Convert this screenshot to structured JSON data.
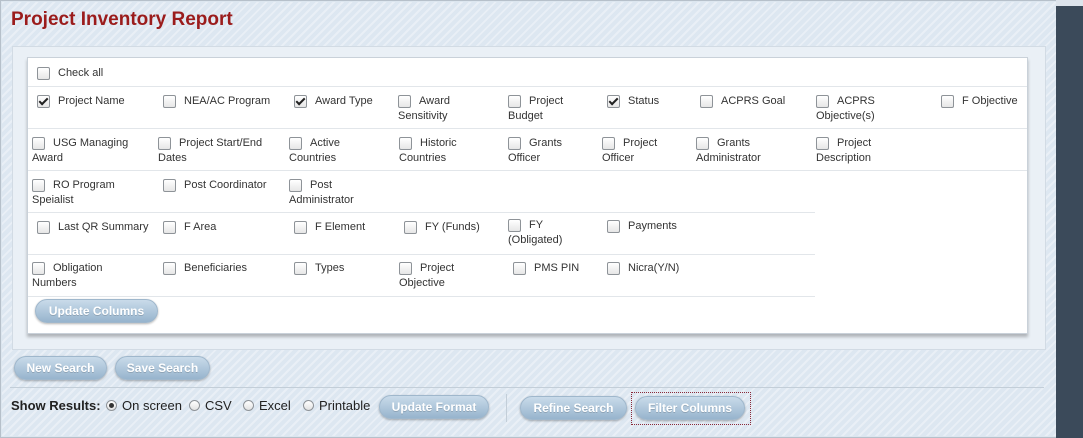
{
  "title": "Project Inventory Report",
  "checkall_label": "Check all",
  "rows": [
    [
      {
        "label": "Project Name",
        "checked": true
      },
      {
        "label": "NEA/AC Program",
        "checked": false
      },
      {
        "label": "Award Type",
        "checked": true
      },
      {
        "label": "Award Sensitivity",
        "checked": false
      },
      {
        "label": "Project Budget",
        "checked": false
      },
      {
        "label": "Status",
        "checked": true
      },
      {
        "label": "ACPRS Goal",
        "checked": false
      },
      {
        "label": "ACPRS Objective(s)",
        "checked": false
      },
      {
        "label": "F Objective",
        "checked": false
      }
    ],
    [
      {
        "label": "USG Managing Award",
        "checked": false
      },
      {
        "label": "Project Start/End Dates",
        "checked": false
      },
      {
        "label": "Active Countries",
        "checked": false
      },
      {
        "label": "Historic Countries",
        "checked": false
      },
      {
        "label": "Grants Officer",
        "checked": false
      },
      {
        "label": "Project Officer",
        "checked": false
      },
      {
        "label": "Grants Administrator",
        "checked": false
      },
      {
        "label": "Project Description",
        "checked": false
      }
    ],
    [
      {
        "label": "RO Program Speialist",
        "checked": false
      },
      {
        "label": "Post Coordinator",
        "checked": false
      },
      {
        "label": "Post Administrator",
        "checked": false
      }
    ],
    [
      {
        "label": "Last QR Summary",
        "checked": false
      },
      {
        "label": "F Area",
        "checked": false
      },
      {
        "label": "F Element",
        "checked": false
      },
      {
        "label": "FY (Funds)",
        "checked": false
      },
      {
        "label": "FY (Obligated)",
        "checked": false
      },
      {
        "label": "Payments",
        "checked": false
      }
    ],
    [
      {
        "label": "Obligation Numbers",
        "checked": false
      },
      {
        "label": "Beneficiaries",
        "checked": false
      },
      {
        "label": "Types",
        "checked": false
      },
      {
        "label": "Project Objective",
        "checked": false
      },
      {
        "label": "PMS PIN",
        "checked": false
      },
      {
        "label": "Nicra(Y/N)",
        "checked": false
      }
    ]
  ],
  "buttons": {
    "update_columns": "Update Columns",
    "new_search": "New Search",
    "save_search": "Save Search",
    "update_format": "Update Format",
    "refine_search": "Refine Search",
    "filter_columns": "Filter Columns"
  },
  "show_results": {
    "label": "Show Results:",
    "options": [
      {
        "label": "On screen",
        "selected": true
      },
      {
        "label": "CSV",
        "selected": false
      },
      {
        "label": "Excel",
        "selected": false
      },
      {
        "label": "Printable",
        "selected": false
      }
    ]
  },
  "colors": {
    "title": "#9b1c1c",
    "button": "#a9c2d8"
  }
}
